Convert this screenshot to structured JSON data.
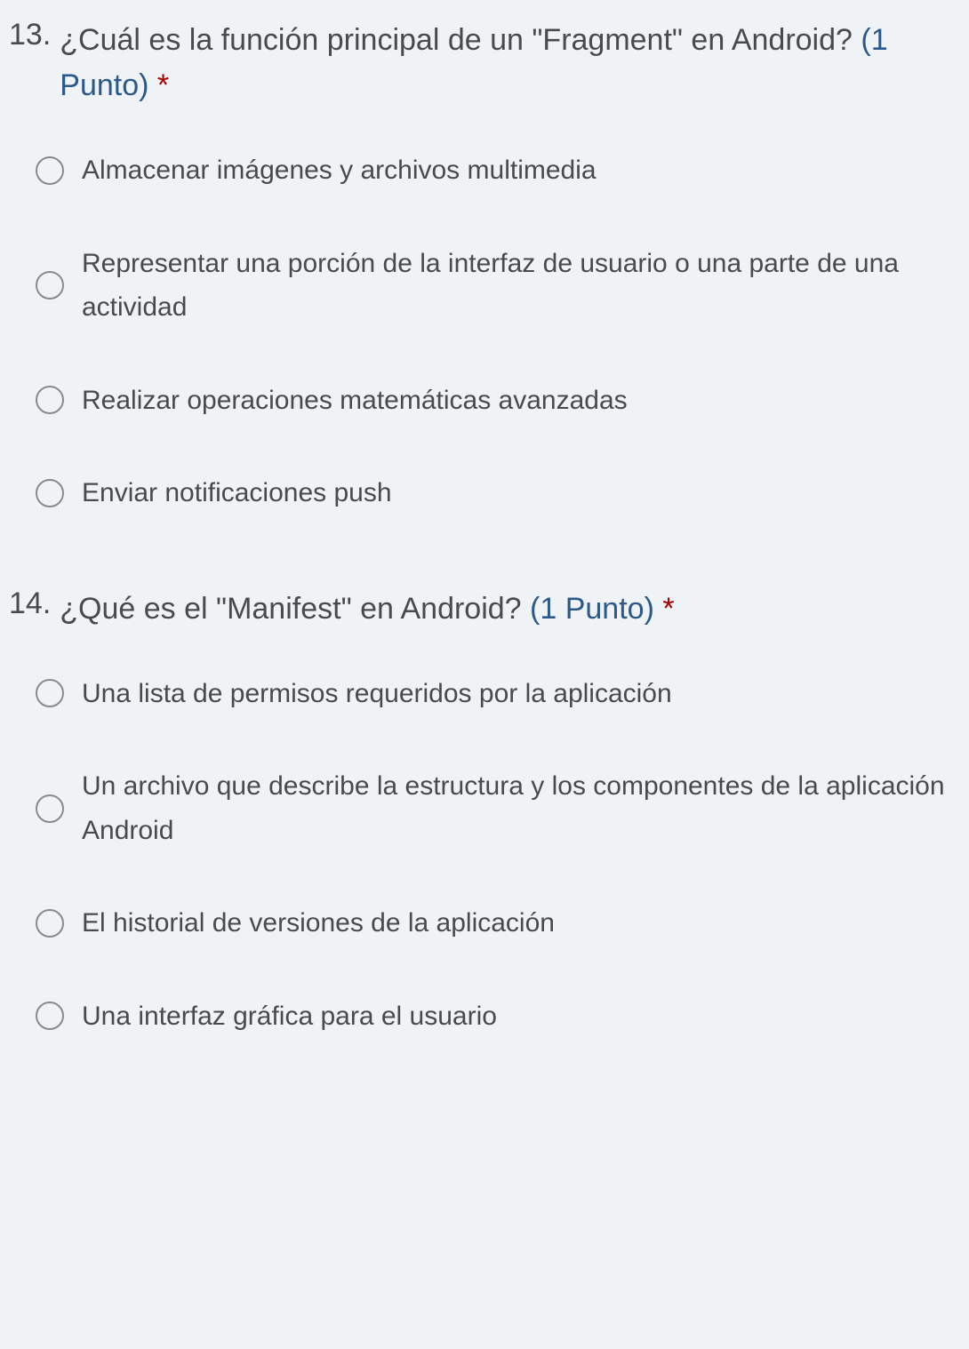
{
  "questions": [
    {
      "number": "13.",
      "text": "¿Cuál es la función principal de un \"Fragment\" en Android?",
      "points": "(1 Punto)",
      "required": "*",
      "options": [
        "Almacenar imágenes y archivos multimedia",
        "Representar una porción de la interfaz de usuario o una parte de una actividad",
        "Realizar operaciones matemáticas avanzadas",
        "Enviar notificaciones push"
      ]
    },
    {
      "number": "14.",
      "text": "¿Qué es el \"Manifest\" en Android?",
      "points": "(1 Punto)",
      "required": "*",
      "options": [
        "Una lista de permisos requeridos por la aplicación",
        "Un archivo que describe la estructura y los componen­tes de la aplicación Android",
        "El historial de versiones de la aplicación",
        "Una interfaz gráfica para el usuario"
      ]
    }
  ]
}
